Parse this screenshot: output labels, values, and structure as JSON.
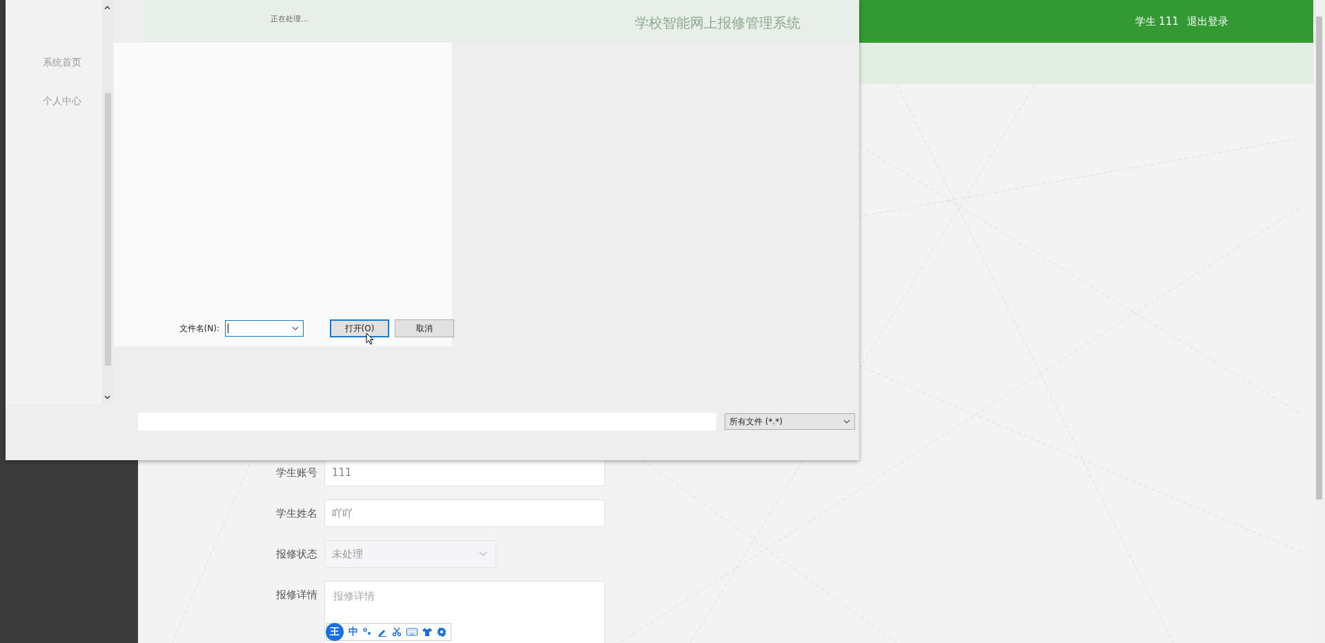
{
  "header": {
    "user": "学生 111",
    "logout": "退出登录"
  },
  "form": {
    "fields": [
      {
        "label": "学生账号",
        "value": "111",
        "kind": "input"
      },
      {
        "label": "学生姓名",
        "value": "吖吖",
        "kind": "input"
      },
      {
        "label": "报修状态",
        "value": "未处理",
        "kind": "select"
      },
      {
        "label": "报修详情",
        "placeholder": "报修详情",
        "kind": "textarea"
      }
    ]
  },
  "ime_toolbar": {
    "logo": "王",
    "mode": "中"
  },
  "dialog": {
    "status": "正在处理...",
    "ghost_title": "学校智能网上报修管理系统",
    "ghost_menu": [
      "系统首页",
      "个人中心"
    ],
    "filename": {
      "label": "文件名(N):"
    },
    "buttons": [
      {
        "label": "打开(O)",
        "kind": "primary"
      },
      {
        "label": "取消",
        "kind": "normal"
      }
    ],
    "file_type": "所有文件 (*.*)"
  }
}
